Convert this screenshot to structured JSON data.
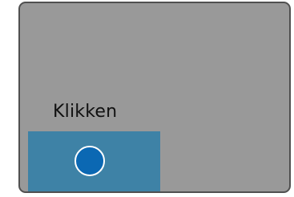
{
  "panel": {
    "label": "Klikken"
  },
  "colors": {
    "panel_bg": "#999999",
    "panel_border": "#505050",
    "click_zone_bg": "#3e82a6",
    "circle_fill": "#0b68b3",
    "circle_stroke": "#ffffff"
  },
  "icons": {
    "target": "circle-button-icon"
  }
}
